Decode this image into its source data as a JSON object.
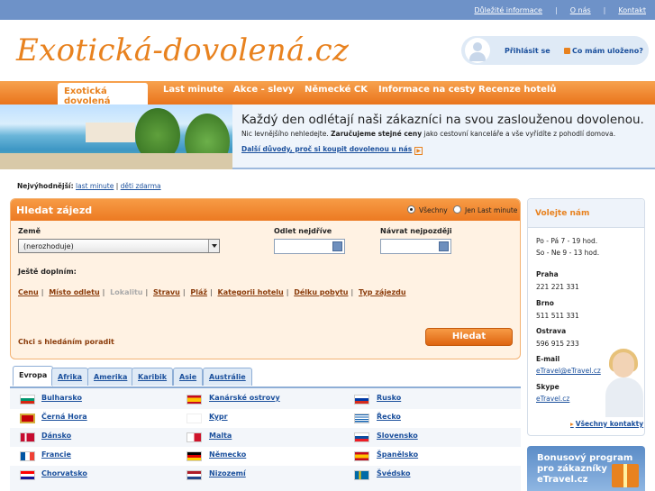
{
  "top_links": [
    "Důležité informace",
    "O nás",
    "Kontakt"
  ],
  "logo": "Exotická-dovolená.cz",
  "user": {
    "login": "Přihlásit se",
    "saved": "Co mám uloženo?"
  },
  "nav": {
    "active": "Exotická dovolená",
    "items": [
      "Last minute",
      "Akce - slevy",
      "Německé CK",
      "Informace na cesty",
      "Recenze hotelů"
    ]
  },
  "banner": {
    "headline": "Každý den odlétají naši zákazníci na svou zaslouženou dovolenou.",
    "sub_pre": "Nic levnějšího nehledejte. ",
    "sub_bold": "Zaručujeme stejné ceny",
    "sub_post": " jako cestovní kanceláře a vše vyřídíte z pohodlí domova.",
    "link": "Další důvody, proč si koupit dovolenou u nás"
  },
  "best": {
    "label": "Nejvýhodnější:",
    "links": [
      "last minute",
      "děti zdarma"
    ]
  },
  "search": {
    "title": "Hledat zájezd",
    "radio_all": "Všechny",
    "radio_lm": "Jen Last minute",
    "country_label": "Země",
    "country_value": "(nerozhoduje)",
    "depart_label": "Odlet nejdříve",
    "return_label": "Návrat nejpozději",
    "more_label": "Ještě doplním:",
    "filters": [
      "Cenu",
      "Místo odletu",
      "Lokalitu",
      "Stravu",
      "Pláž",
      "Kategorii hotelu",
      "Délku pobytu",
      "Typ zájezdu"
    ],
    "advice": "Chci s hledáním poradit",
    "button": "Hledat"
  },
  "region_tabs": [
    "Evropa",
    "Afrika",
    "Amerika",
    "Karibik",
    "Asie",
    "Austrálie"
  ],
  "countries": [
    [
      "Bulharsko",
      "Kanárské ostrovy",
      "Rusko"
    ],
    [
      "Černá Hora",
      "Kypr",
      "Řecko"
    ],
    [
      "Dánsko",
      "Malta",
      "Slovensko"
    ],
    [
      "Francie",
      "Německo",
      "Španělsko"
    ],
    [
      "Chorvatsko",
      "Nizozemí",
      "Švédsko"
    ]
  ],
  "sidebar": {
    "title": "Volejte nám",
    "hours1": "Po - Pá 7 - 19 hod.",
    "hours2": "So - Ne 9 - 13 hod.",
    "praha": "Praha",
    "praha_tel": "221 221 331",
    "brno": "Brno",
    "brno_tel": "511 511 331",
    "ostrava": "Ostrava",
    "ostrava_tel": "596 915 233",
    "email_label": "E-mail",
    "email": "eTravel@eTravel.cz",
    "skype_label": "Skype",
    "skype": "eTravel.cz",
    "all_contacts": "Všechny kontakty"
  },
  "bonus": {
    "line1": "Bonusový program",
    "line2": "pro zákazníky",
    "line3": "eTravel.cz"
  }
}
